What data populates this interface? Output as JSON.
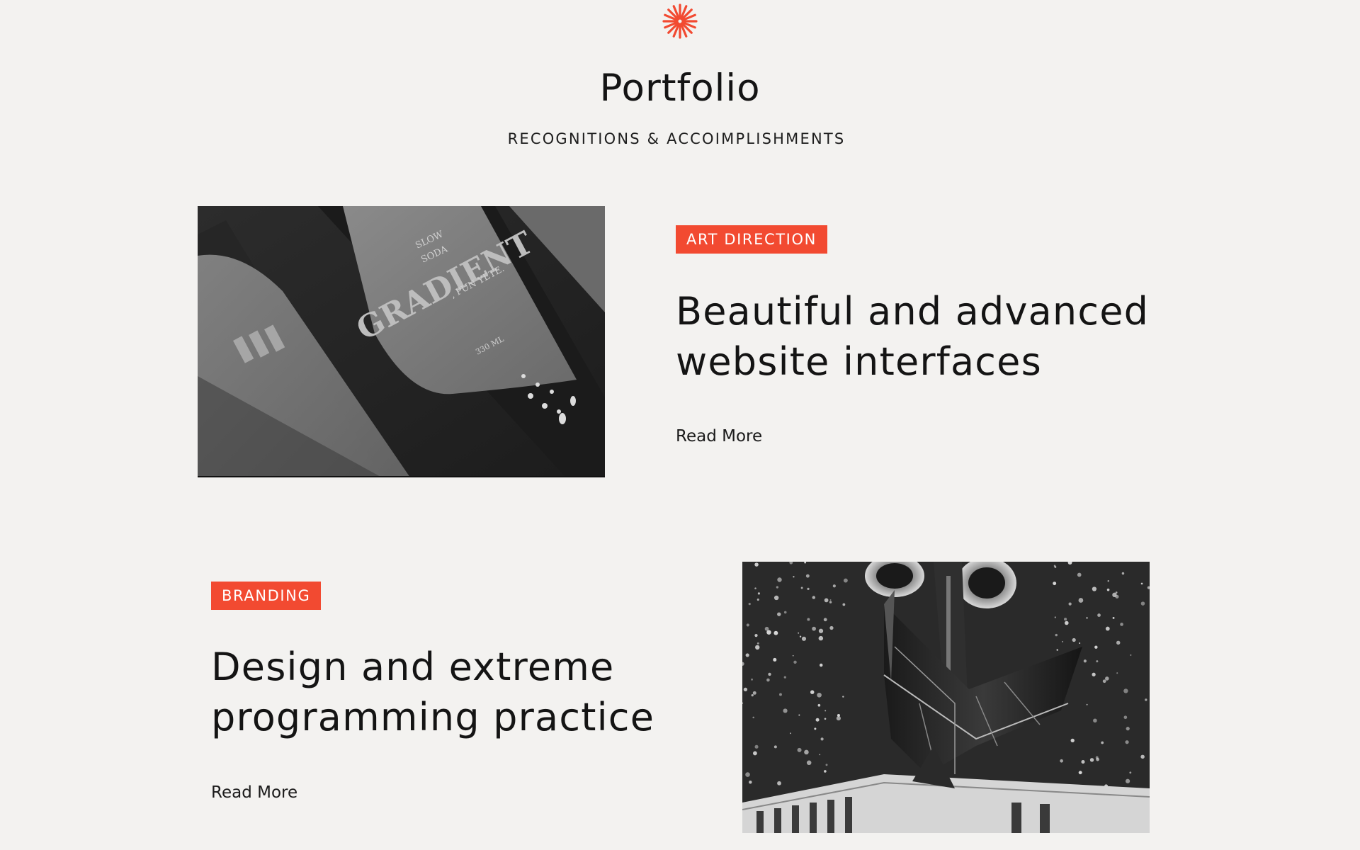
{
  "header": {
    "logo_icon": "sunburst-logo-icon",
    "accent_color": "#f24a31",
    "title": "Portfolio",
    "subtitle": "RECOGNITIONS & ACCOIMPLISHMENTS"
  },
  "items": [
    {
      "tag": "ART DIRECTION",
      "title_line1": "Beautiful and advanced",
      "title_line2": "website interfaces",
      "link": "Read More",
      "image": "soda-bottles-image",
      "image_text": {
        "brand_line1": "SLOW",
        "brand_line2": "SODA",
        "product": "GRADIENT",
        "tagline": ", PUN YETE.",
        "volume": "330 ML"
      }
    },
    {
      "tag": "BRANDING",
      "title_line1": "Design and extreme",
      "title_line2": "programming practice",
      "link": "Read More",
      "image": "abstract-3d-sculpture-image"
    }
  ]
}
